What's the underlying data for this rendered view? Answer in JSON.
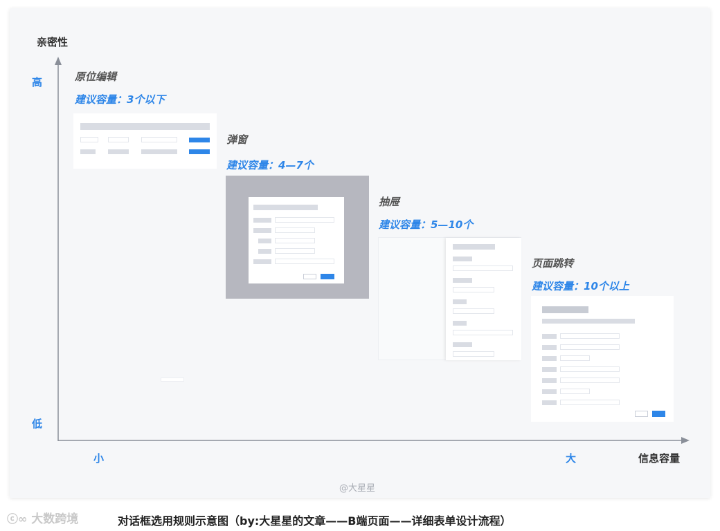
{
  "axes": {
    "y_title": "亲密性",
    "y_high": "高",
    "y_low": "低",
    "x_title": "信息容量",
    "x_small": "小",
    "x_large": "大"
  },
  "groups": [
    {
      "title": "原位编辑",
      "capacity": "建议容量：3个以下"
    },
    {
      "title": "弹窗",
      "capacity": "建议容量：4—7个"
    },
    {
      "title": "抽屉",
      "capacity": "建议容量：5—10个"
    },
    {
      "title": "页面跳转",
      "capacity": "建议容量：10个以上"
    }
  ],
  "watermark_center": "@大星星",
  "watermark_brand": "大数跨境",
  "caption": "对话框选用规则示意图（by:大星星的文章——B端页面——详细表单设计流程）",
  "colors": {
    "accent": "#2e86e8",
    "overlay": "#b6b7bf",
    "axis": "#8a8f99"
  }
}
